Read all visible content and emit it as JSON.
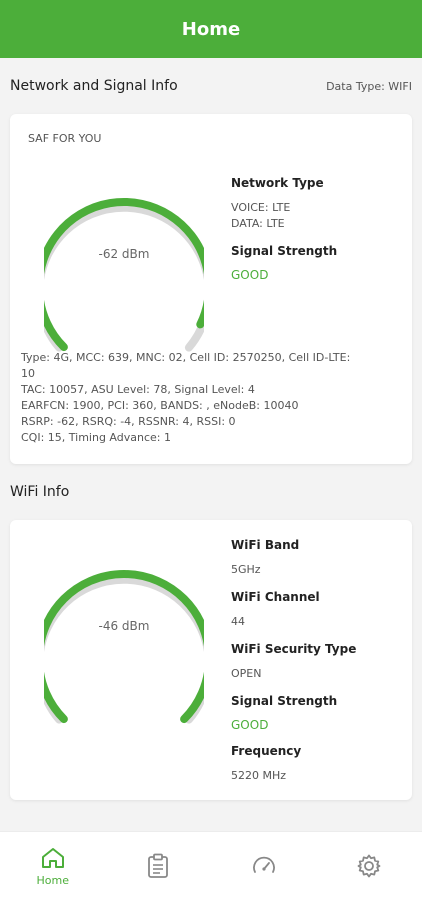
{
  "header": {
    "title": "Home"
  },
  "network_section": {
    "title": "Network and Signal Info",
    "data_type": "Data Type: WIFI"
  },
  "network_card": {
    "operator": "SAF FOR YOU",
    "gauge": {
      "value_text": "-62 dBm",
      "fill_fraction": 0.93
    },
    "network_type": {
      "label": "Network Type",
      "voice": "VOICE: LTE",
      "data": "DATA: LTE"
    },
    "signal_strength": {
      "label": "Signal Strength",
      "value": "GOOD"
    },
    "details": [
      "Type: 4G, MCC: 639, MNC: 02, Cell ID: 2570250, Cell ID-LTE: 10",
      "TAC: 10057, ASU Level: 78, Signal Level: 4",
      "EARFCN: 1900, PCI: 360, BANDS: , eNodeB: 10040",
      "RSRP: -62, RSRQ: -4, RSSNR: 4, RSSI: 0",
      "CQI: 15, Timing Advance: 1"
    ]
  },
  "wifi_section": {
    "title": "WiFi Info"
  },
  "wifi_card": {
    "gauge": {
      "value_text": "-46 dBm",
      "fill_fraction": 1.0
    },
    "band": {
      "label": "WiFi Band",
      "value": "5GHz"
    },
    "channel": {
      "label": "WiFi Channel",
      "value": "44"
    },
    "security": {
      "label": "WiFi Security Type",
      "value": "OPEN"
    },
    "signal_strength": {
      "label": "Signal Strength",
      "value": "GOOD"
    },
    "frequency": {
      "label": "Frequency",
      "value": "5220 MHz"
    }
  },
  "bottom_nav": {
    "items": [
      {
        "label": "Home",
        "icon": "home-icon",
        "active": true
      },
      {
        "label": "",
        "icon": "clipboard-icon",
        "active": false
      },
      {
        "label": "",
        "icon": "speedometer-icon",
        "active": false
      },
      {
        "label": "",
        "icon": "gear-icon",
        "active": false
      }
    ]
  },
  "colors": {
    "accent": "#4cae3a",
    "gauge_track": "#d9d9d9"
  }
}
